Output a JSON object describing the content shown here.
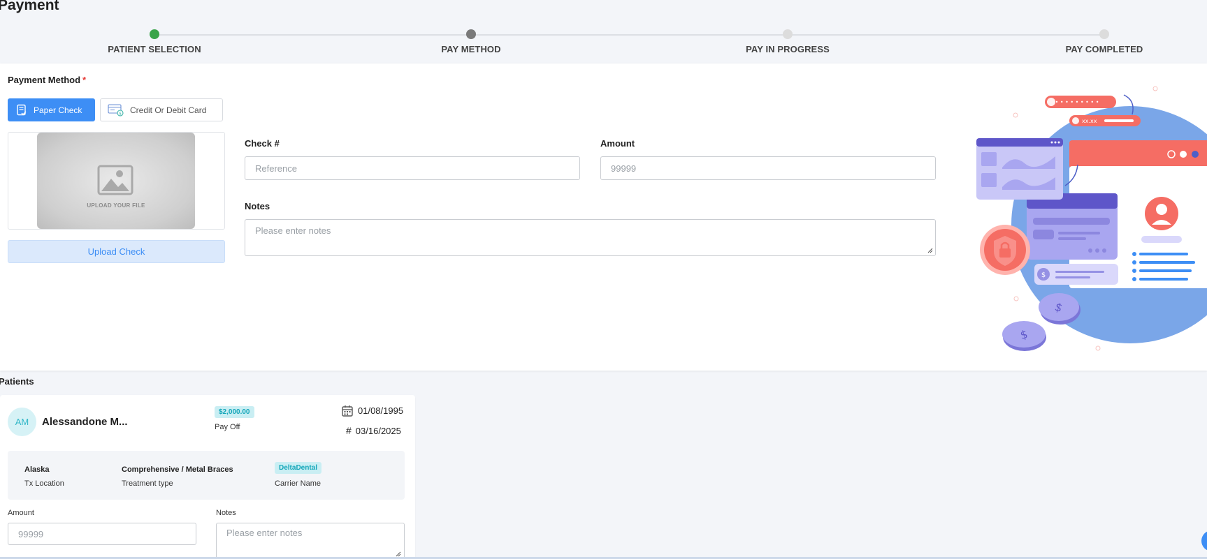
{
  "page": {
    "title": "Payment"
  },
  "stepper": {
    "steps": [
      {
        "label": "PATIENT SELECTION",
        "status": "completed",
        "color": "#3aa44a"
      },
      {
        "label": "PAY METHOD",
        "status": "current",
        "color": "#7a7a7a"
      },
      {
        "label": "PAY IN PROGRESS",
        "status": "pending",
        "color": "#dcdcdc"
      },
      {
        "label": "PAY COMPLETED",
        "status": "pending",
        "color": "#dcdcdc"
      }
    ]
  },
  "payment_method": {
    "label": "Payment Method",
    "required_mark": "*",
    "options": [
      {
        "label": "Paper Check",
        "icon": "paper-check-icon",
        "selected": true
      },
      {
        "label": "Credit Or Debit Card",
        "icon": "credit-card-icon",
        "selected": false
      }
    ],
    "upload_placeholder": "UPLOAD YOUR FILE",
    "upload_button": "Upload Check"
  },
  "check_form": {
    "check_label": "Check #",
    "check_placeholder": "Reference",
    "amount_label": "Amount",
    "amount_placeholder": "99999",
    "notes_label": "Notes",
    "notes_placeholder": "Please enter notes"
  },
  "illustration": {
    "masked_text": "xx.xx"
  },
  "patients": {
    "title": "Patients",
    "items": [
      {
        "initials": "AM",
        "name": "Alessandone M...",
        "amount_badge": "$2,000.00",
        "status": "Pay Off",
        "dob": "01/08/1995",
        "ref_date": "03/16/2025",
        "tx_location": {
          "value": "Alaska",
          "label": "Tx Location"
        },
        "treatment_type": {
          "value": "Comprehensive / Metal Braces",
          "label": "Treatment type"
        },
        "carrier": {
          "value": "DeltaDental",
          "label": "Carrier Name"
        },
        "amount_label": "Amount",
        "amount_placeholder": "99999",
        "notes_label": "Notes",
        "notes_placeholder": "Please enter notes"
      }
    ]
  },
  "colors": {
    "accent": "#3d8ef5",
    "badge_bg": "#c9eef3",
    "badge_text": "#14a6b9",
    "illustration_blue": "#7aa6e8",
    "illustration_coral": "#f56d64",
    "illustration_purple": "#a9a6f0"
  }
}
